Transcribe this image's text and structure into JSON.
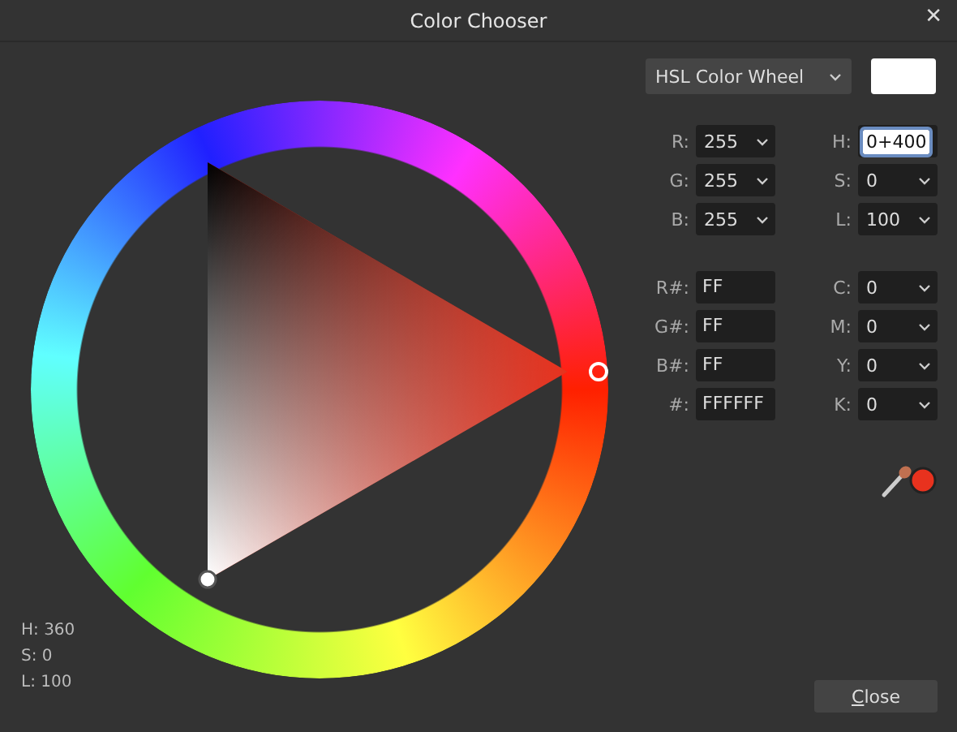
{
  "window": {
    "title": "Color Chooser",
    "close_glyph": "✕"
  },
  "mode_dropdown": {
    "value": "HSL Color Wheel"
  },
  "preview": {
    "color": "#ffffff"
  },
  "rgb_fields": [
    {
      "label": "R:",
      "value": "255",
      "focused": false
    },
    {
      "label": "G:",
      "value": "255",
      "focused": false
    },
    {
      "label": "B:",
      "value": "255",
      "focused": false
    }
  ],
  "hsl_fields": [
    {
      "label": "H:",
      "value": "0+400",
      "focused": true
    },
    {
      "label": "S:",
      "value": "0",
      "focused": false
    },
    {
      "label": "L:",
      "value": "100",
      "focused": false
    }
  ],
  "hex_fields": [
    {
      "label": "R#:",
      "value": "FF"
    },
    {
      "label": "G#:",
      "value": "FF"
    },
    {
      "label": "B#:",
      "value": "FF"
    },
    {
      "label": "#:",
      "value": "FFFFFF"
    }
  ],
  "cmyk_fields": [
    {
      "label": "C:",
      "value": "0"
    },
    {
      "label": "M:",
      "value": "0"
    },
    {
      "label": "Y:",
      "value": "0"
    },
    {
      "label": "K:",
      "value": "0"
    }
  ],
  "picker_color": {
    "color": "#e8321e"
  },
  "readout": [
    "H: 360",
    "S: 0",
    "L: 100"
  ],
  "close_button": {
    "label_parts": [
      {
        "text": "C",
        "underlined": true
      },
      {
        "text": "lose",
        "underlined": false
      }
    ]
  }
}
